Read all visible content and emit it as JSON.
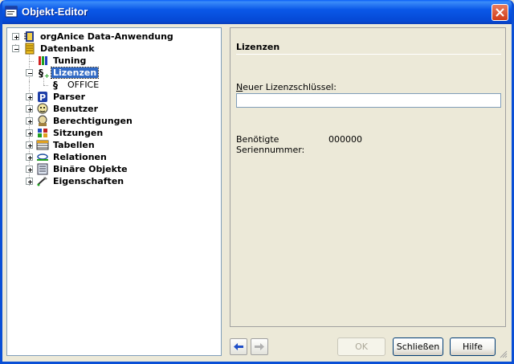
{
  "window": {
    "title": "Objekt-Editor"
  },
  "tree": {
    "items": [
      {
        "label": "orgAnice Data-Anwendung",
        "expander": "+"
      },
      {
        "label": "Datenbank",
        "expander": "-"
      },
      {
        "label": "Tuning"
      },
      {
        "label": "Lizenzen",
        "expander": "-",
        "selected": true
      },
      {
        "label": "OFFICE"
      },
      {
        "label": "Parser",
        "expander": "+"
      },
      {
        "label": "Benutzer",
        "expander": "+"
      },
      {
        "label": "Berechtigungen",
        "expander": "+"
      },
      {
        "label": "Sitzungen",
        "expander": "+"
      },
      {
        "label": "Tabellen",
        "expander": "+"
      },
      {
        "label": "Relationen",
        "expander": "+"
      },
      {
        "label": "Binäre Objekte",
        "expander": "+"
      },
      {
        "label": "Eigenschaften",
        "expander": "+"
      }
    ]
  },
  "detail": {
    "section_title": "Lizenzen",
    "license_key_label_accel": "N",
    "license_key_label_rest": "euer Lizenzschlüssel:",
    "license_key_value": "",
    "serial_label": "Benötigte Seriennummer:",
    "serial_value": "000000"
  },
  "buttons": {
    "ok": "OK",
    "close": "Schließen",
    "help": "Hilfe"
  },
  "colors": {
    "titlebar": "#0a58e8",
    "selection": "#316ac5",
    "window_bg": "#ece9d8"
  }
}
